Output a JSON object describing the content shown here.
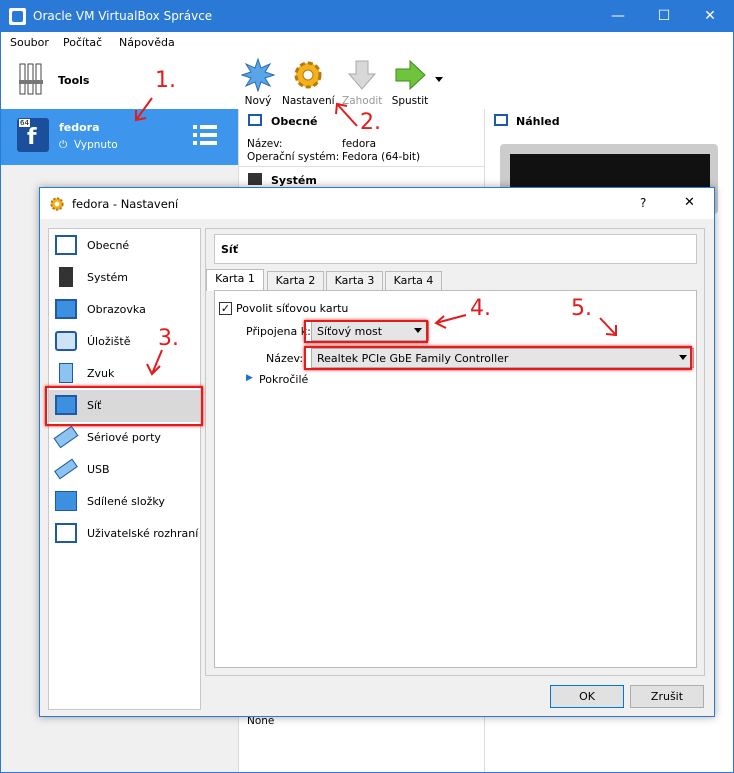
{
  "main_window": {
    "title": "Oracle VM VirtualBox Správce",
    "menu": [
      "Soubor",
      "Počítač",
      "Nápověda"
    ]
  },
  "left_pane": {
    "tools_label": "Tools",
    "vm": {
      "name": "fedora",
      "state": "Vypnuto",
      "badge": "64"
    }
  },
  "toolbar": {
    "new": "Nový",
    "settings": "Nastavení",
    "discard": "Zahodit",
    "start": "Spustit"
  },
  "details": {
    "general_header": "Obecné",
    "name_label": "Název:",
    "name_value": "fedora",
    "os_label": "Operační systém:",
    "os_value": "Fedora (64-bit)",
    "system_header": "Systém",
    "bottom_value": "None",
    "preview_header": "Náhled"
  },
  "dialog": {
    "title": "fedora - Nastavení",
    "help": "?",
    "close": "✕",
    "categories": [
      "Obecné",
      "Systém",
      "Obrazovka",
      "Úložiště",
      "Zvuk",
      "Síť",
      "Sériové porty",
      "USB",
      "Sdílené složky",
      "Uživatelské rozhraní"
    ],
    "selected_category": "Síť",
    "page_title": "Síť",
    "tabs": [
      "Karta 1",
      "Karta 2",
      "Karta 3",
      "Karta 4"
    ],
    "enable_adapter": "Povolit síťovou kartu",
    "attached_label": "Připojena k:",
    "attached_value": "Síťový most",
    "name_label": "Název:",
    "name_value": "Realtek PCIe GbE Family Controller",
    "advanced": "Pokročilé",
    "ok": "OK",
    "cancel": "Zrušit"
  },
  "annotations": {
    "a1": "1.",
    "a2": "2.",
    "a3": "3.",
    "a4": "4.",
    "a5": "5."
  },
  "colors": {
    "accent": "#2b79d6",
    "vm_selected": "#3d96ec",
    "annotation": "#e21b1b"
  }
}
